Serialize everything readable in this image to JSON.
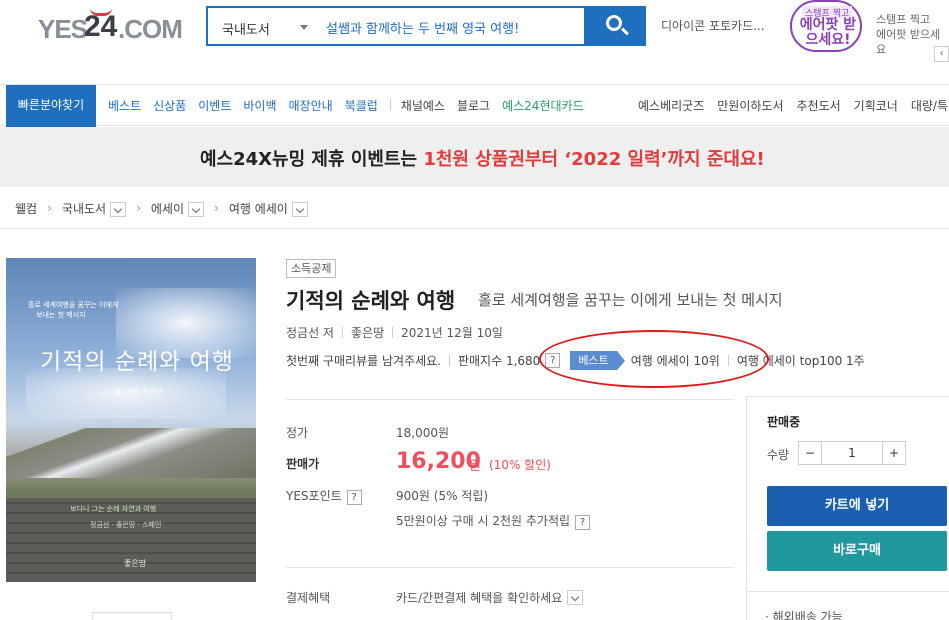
{
  "header": {
    "logo": {
      "yes": "YES",
      "num": "24",
      "com": ".COM"
    },
    "search": {
      "category": "국내도서",
      "query": "설쌤과 함께하는 두 번째 영국 여행!"
    },
    "promo_link": "디아이콘 포토카드...",
    "stamp": {
      "small": "스탬프 찍고",
      "big": "에어팟 받으세요!"
    },
    "stamp_text": [
      "스탬프 찍고",
      "에어팟 받으세요"
    ]
  },
  "nav": {
    "quick": "빠른분야찾기",
    "items": [
      "베스트",
      "신상품",
      "이벤트",
      "바이백",
      "매장안내",
      "북클럽",
      "채널예스",
      "블로그",
      "예스24현대카드"
    ],
    "right_items": [
      "예스베리굿즈",
      "만원이하도서",
      "추천도서",
      "기획코너",
      "대량/특"
    ]
  },
  "banner": {
    "black": "예스24X뉴밍 제휴 이벤트는 ",
    "red": "1천원 상품권부터 ‘2022 일력’까지 준대요!"
  },
  "breadcrumb": [
    "웰컴",
    "국내도서",
    "에세이",
    "여행 에세이"
  ],
  "cover": {
    "sub1": "홀로 세계여행을 꿈꾸는 이에게",
    "sub2": "보내는 첫 메시지",
    "title": "기적의 순례와 여행",
    "author": "글 · 사진 정금선",
    "line": "보다니 그는 순례 자연과 여행",
    "line2": "정금선 · 좋은땅 · 스페인",
    "publisher": "좋은땅"
  },
  "book": {
    "badge": "소득공제",
    "title": "기적의 순례와 여행",
    "subtitle": "홀로 세계여행을 꿈꾸는 이에게 보내는 첫 메시지",
    "author": "정금선 저",
    "publisher": "좋은땅",
    "date": "2021년 12월 10일",
    "review_prompt": "첫번째 구매리뷰를 남겨주세요.",
    "sales_index": "판매지수 1,680",
    "best_label": "베스트",
    "rank1": "여행 에세이 10위",
    "rank2": "여행 에세이 top100 1주"
  },
  "price": {
    "list_label": "정가",
    "list_value": "18,000원",
    "sale_label": "판매가",
    "sale_value": "16,200",
    "sale_unit": "원",
    "discount": "(10% 할인)",
    "points_label": "YES포인트",
    "points_value": "900원 (5% 적립)",
    "extra_points": "5만원이상 구매 시 2천원 추가적립",
    "pay_label": "결제혜택",
    "pay_value": "카드/간편결제 혜택을 확인하세요"
  },
  "panel": {
    "status": "판매중",
    "qty_label": "수량",
    "qty": "1",
    "minus": "−",
    "plus": "+",
    "cart": "카트에 넣기",
    "buy": "바로구매",
    "ship": "· 해외배송 가능"
  },
  "misc": {
    "help": "?",
    "scroll_arrow": "‹"
  }
}
